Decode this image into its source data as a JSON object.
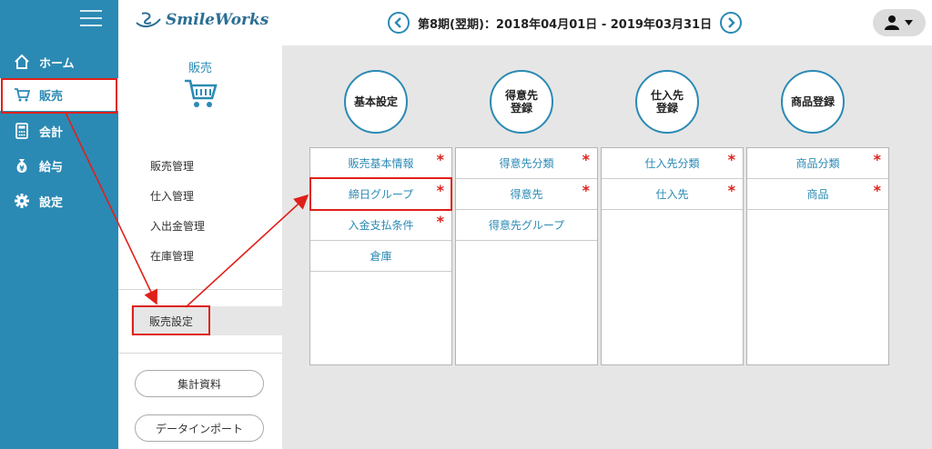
{
  "topbar": {
    "logo": "SmileWorks",
    "period": "第8期(翌期)：2018年04月01日 - 2019年03月31日"
  },
  "nav": {
    "items": [
      {
        "label": "ホーム",
        "icon": "home-icon"
      },
      {
        "label": "販売",
        "icon": "cart-icon"
      },
      {
        "label": "会計",
        "icon": "calculator-icon"
      },
      {
        "label": "給与",
        "icon": "money-bag-icon"
      },
      {
        "label": "設定",
        "icon": "gear-icon"
      }
    ],
    "active": "販売"
  },
  "submenu": {
    "title": "販売",
    "items": [
      "販売管理",
      "仕入管理",
      "入出金管理",
      "在庫管理"
    ],
    "selected": "販売設定",
    "buttons": [
      "集計資料",
      "データインポート"
    ]
  },
  "categories": [
    {
      "title": "基本設定",
      "rows": [
        {
          "label": "販売基本情報",
          "required": true
        },
        {
          "label": "締日グループ",
          "required": true
        },
        {
          "label": "入金支払条件",
          "required": true
        },
        {
          "label": "倉庫",
          "required": false
        }
      ]
    },
    {
      "title": "得意先\n登録",
      "rows": [
        {
          "label": "得意先分類",
          "required": true
        },
        {
          "label": "得意先",
          "required": true
        },
        {
          "label": "得意先グループ",
          "required": false
        }
      ]
    },
    {
      "title": "仕入先\n登録",
      "rows": [
        {
          "label": "仕入先分類",
          "required": true
        },
        {
          "label": "仕入先",
          "required": true
        }
      ]
    },
    {
      "title": "商品登録",
      "rows": [
        {
          "label": "商品分類",
          "required": true
        },
        {
          "label": "商品",
          "required": true
        }
      ]
    }
  ],
  "required_mark": "*",
  "colors": {
    "accent": "#2b8ab4",
    "highlight": "#e0201a"
  }
}
